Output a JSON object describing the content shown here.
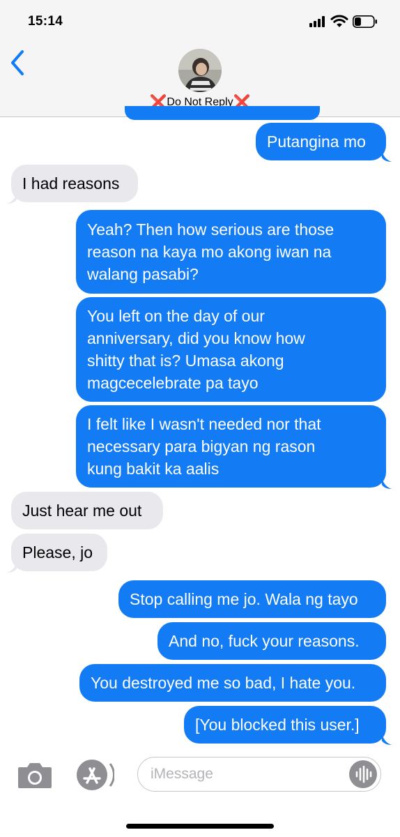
{
  "status_bar": {
    "time": "15:14",
    "battery_level": 0.35
  },
  "header": {
    "contact_name": "Do Not Reply",
    "name_prefix_emoji": "❌",
    "name_suffix_emoji": "❌",
    "avatar_icon": "contact-photo"
  },
  "messages": [
    {
      "from": "me",
      "text": "Putangina mo"
    },
    {
      "from": "them",
      "text": "I had reasons"
    },
    {
      "from": "me",
      "text": "Yeah? Then how serious are those\nreason na kaya mo akong iwan na\nwalang pasabi?"
    },
    {
      "from": "me",
      "text": "You left on the day of our\nanniversary, did you know how\nshitty that is? Umasa akong\nmagcecelebrate pa tayo"
    },
    {
      "from": "me",
      "text": "I felt like I wasn't needed nor that\nnecessary para bigyan ng rason\nkung bakit ka aalis"
    },
    {
      "from": "them",
      "text": "Just hear me out"
    },
    {
      "from": "them",
      "text": "Please, jo"
    },
    {
      "from": "me",
      "text": "Stop calling me jo. Wala ng tayo"
    },
    {
      "from": "me",
      "text": "And no, fuck your reasons."
    },
    {
      "from": "me",
      "text": "You destroyed me so bad, I hate you."
    },
    {
      "from": "me",
      "text": "[You blocked this user.]"
    }
  ],
  "input_bar": {
    "placeholder": "iMessage",
    "icons": [
      "camera-icon",
      "app-store-icon",
      "audio-waveform-icon"
    ]
  },
  "colors": {
    "sent_bubble": "#137cf5",
    "received_bubble": "#e8e8ed",
    "header_bg": "#f5f5f6",
    "accent": "#137cf5"
  }
}
